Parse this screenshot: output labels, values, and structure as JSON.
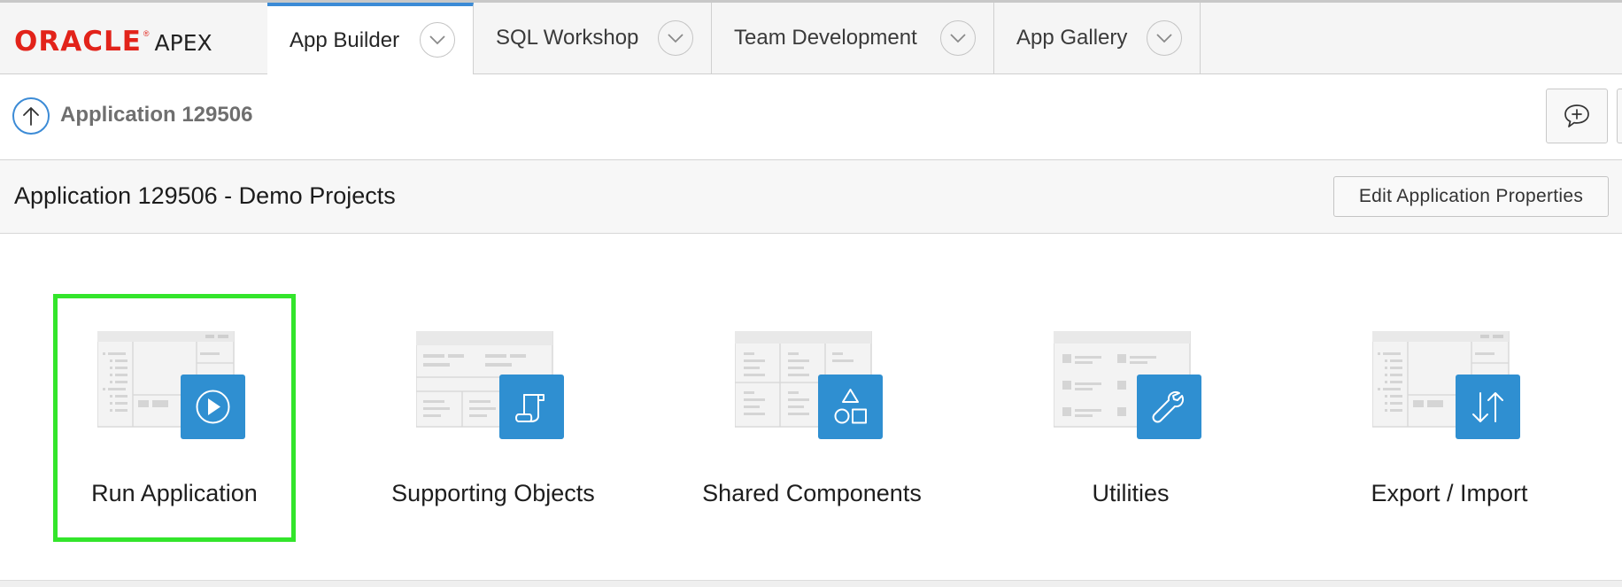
{
  "brand": {
    "oracle": "ORACLE",
    "reg": "®",
    "product": "APEX",
    "color": "#e2231a"
  },
  "nav": {
    "tabs": [
      {
        "label": "App Builder",
        "active": true
      },
      {
        "label": "SQL Workshop",
        "active": false
      },
      {
        "label": "Team Development",
        "active": false
      },
      {
        "label": "App Gallery",
        "active": false
      }
    ]
  },
  "breadcrumb": {
    "title": "Application 129506",
    "up_icon": "arrow-up-icon",
    "feedback_icon": "feedback-icon"
  },
  "page": {
    "title": "Application 129506 - Demo Projects",
    "edit_button": "Edit Application Properties"
  },
  "tiles": [
    {
      "label": "Run Application",
      "icon": "play-icon",
      "selected": true
    },
    {
      "label": "Supporting Objects",
      "icon": "scroll-icon",
      "selected": false
    },
    {
      "label": "Shared Components",
      "icon": "shapes-icon",
      "selected": false
    },
    {
      "label": "Utilities",
      "icon": "wrench-icon",
      "selected": false
    },
    {
      "label": "Export / Import",
      "icon": "transfer-icon",
      "selected": false
    }
  ],
  "colors": {
    "accent": "#3c8bd6",
    "tile_icon_bg": "#2f8fd1",
    "selection_border": "#33e52b"
  }
}
